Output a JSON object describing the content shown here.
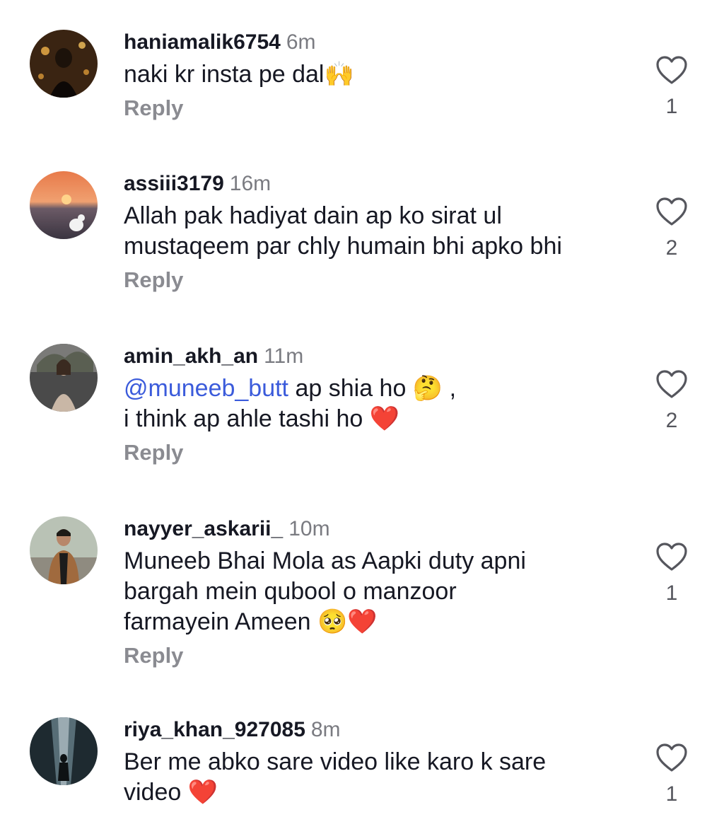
{
  "comments": [
    {
      "username": "haniamalik6754",
      "time": "6m",
      "text": "naki kr insta pe dal",
      "emoji": "🙌",
      "reply": "Reply",
      "likes": "1"
    },
    {
      "username": "assiii3179",
      "time": "16m",
      "line1": "Allah pak hadiyat dain ap ko sirat ul",
      "line2": "mustaqeem par chly humain bhi apko bhi",
      "reply": "Reply",
      "likes": "2"
    },
    {
      "username": "amin_akh_an",
      "time": "11m",
      "mention": "@muneeb_butt",
      "line1_rest": " ap shia ho ",
      "emoji1": "🤔",
      "line1_tail": " ,",
      "line2": "i think ap ahle tashi ho ",
      "emoji2": "❤️",
      "reply": "Reply",
      "likes": "2"
    },
    {
      "username": "nayyer_askarii_",
      "time": "10m",
      "line1": "Muneeb Bhai Mola as Aapki duty apni",
      "line2": "bargah mein qubool o manzoor",
      "line3": "farmayein Ameen ",
      "emoji": "🥺❤️",
      "reply": "Reply",
      "likes": "1"
    },
    {
      "username": "riya_khan_927085",
      "time": "8m",
      "line1": "Ber me abko sare video like karo k sare",
      "line2": "video ",
      "emoji": "❤️",
      "likes": "1"
    }
  ],
  "colors": {
    "mention": "#3b5bdb",
    "heart": "#e0242f",
    "muted": "#8a8b91"
  }
}
